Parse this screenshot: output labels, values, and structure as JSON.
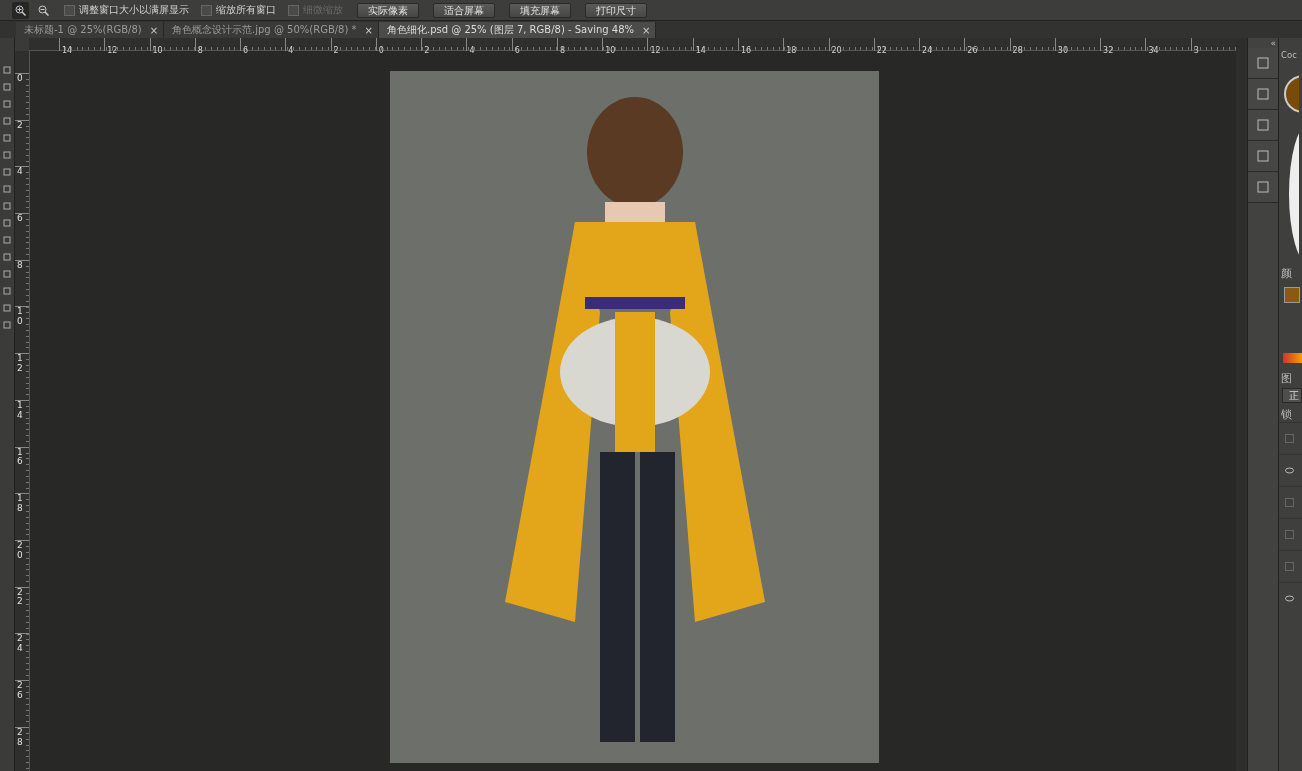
{
  "options_bar": {
    "zoom_tools": [
      {
        "kind": "zoom-in",
        "selected": true
      },
      {
        "kind": "zoom-out",
        "selected": false
      }
    ],
    "checkboxes": [
      {
        "label": "调整窗口大小以满屏显示",
        "checked": false,
        "disabled": false
      },
      {
        "label": "缩放所有窗口",
        "checked": false,
        "disabled": false
      },
      {
        "label": "细微缩放",
        "checked": false,
        "disabled": true
      }
    ],
    "buttons": [
      "实际像素",
      "适合屏幕",
      "填充屏幕",
      "打印尺寸"
    ]
  },
  "tabs": [
    {
      "label": "未标题-1 @ 25%(RGB/8)",
      "close": "×",
      "selected": false
    },
    {
      "label": "角色概念设计示范.jpg @ 50%(RGB/8) *",
      "close": "×",
      "selected": false
    },
    {
      "label": "角色细化.psd @ 25% (图层 7, RGB/8) - Saving 48%",
      "close": "×",
      "selected": true
    }
  ],
  "horizontal_ruler": [
    "14",
    "12",
    "10",
    "8",
    "6",
    "4",
    "2",
    "0",
    "2",
    "4",
    "6",
    "8",
    "10",
    "12",
    "14",
    "16",
    "18",
    "20",
    "22",
    "24",
    "26",
    "28",
    "30",
    "32",
    "34",
    "3"
  ],
  "vertical_ruler": [
    "0",
    "2",
    "4",
    "6",
    "8",
    "10",
    "12",
    "14",
    "16",
    "18",
    "20",
    "22",
    "24",
    "26",
    "28"
  ],
  "panels": {
    "collapse": "«",
    "color_panel_title": "Coc",
    "swatches_title": "颜",
    "layers_title": "图",
    "blend_mode": "正",
    "lock_label": "锁",
    "layers": [
      {
        "visible": false
      },
      {
        "visible": true
      },
      {
        "visible": false
      },
      {
        "visible": false
      },
      {
        "visible": false
      },
      {
        "visible": true
      }
    ]
  }
}
